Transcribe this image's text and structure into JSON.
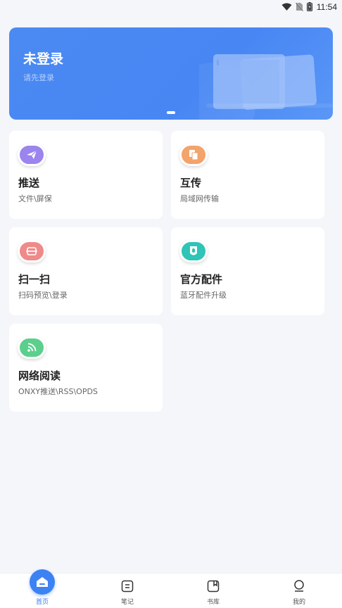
{
  "status_bar": {
    "time": "11:54"
  },
  "banner": {
    "title": "未登录",
    "subtitle": "请先登录"
  },
  "cards": [
    {
      "title": "推送",
      "subtitle": "文件\\屏保",
      "icon": "send-icon",
      "color": "#9b84ee"
    },
    {
      "title": "互传",
      "subtitle": "局域网传输",
      "icon": "transfer-icon",
      "color": "#f3a36b"
    },
    {
      "title": "扫一扫",
      "subtitle": "扫码预览\\登录",
      "icon": "scan-icon",
      "color": "#ef8a8a"
    },
    {
      "title": "官方配件",
      "subtitle": "蓝牙配件升级",
      "icon": "accessory-icon",
      "color": "#2ec4b6"
    },
    {
      "title": "网络阅读",
      "subtitle": "ONXY推送\\RSS\\OPDS",
      "icon": "rss-icon",
      "color": "#5ccf8d"
    }
  ],
  "tabbar": {
    "items": [
      {
        "label": "首页",
        "icon": "home-icon",
        "active": true
      },
      {
        "label": "笔记",
        "icon": "note-icon",
        "active": false
      },
      {
        "label": "书库",
        "icon": "library-icon",
        "active": false
      },
      {
        "label": "我的",
        "icon": "profile-icon",
        "active": false
      }
    ]
  }
}
